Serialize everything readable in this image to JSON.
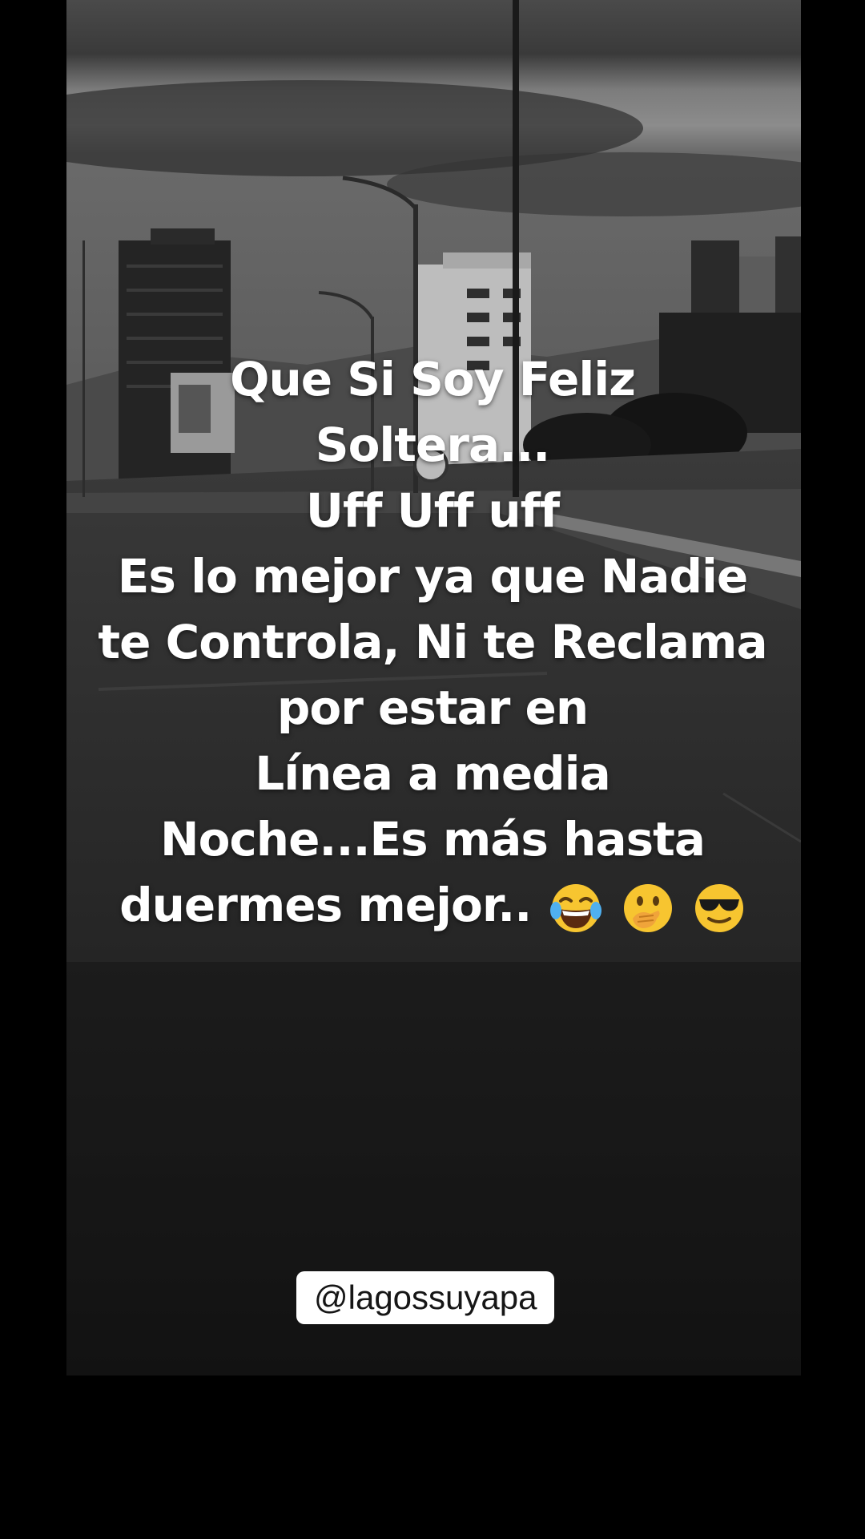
{
  "caption": {
    "lines": [
      "Que Si Soy Feliz",
      "Soltera...",
      "Uff Uff uff",
      "Es lo mejor ya que Nadie",
      "te Controla, Ni te Reclama",
      "por estar en",
      "Línea a media",
      "Noche...Es más hasta",
      "duermes mejor.."
    ],
    "emojis": [
      "laughing-tears-emoji",
      "hand-over-mouth-emoji",
      "sunglasses-emoji"
    ]
  },
  "username": "@lagossuyapa",
  "colors": {
    "background": "#000000",
    "caption_text": "#ffffff",
    "tag_background": "#ffffff",
    "tag_text": "#161616"
  }
}
